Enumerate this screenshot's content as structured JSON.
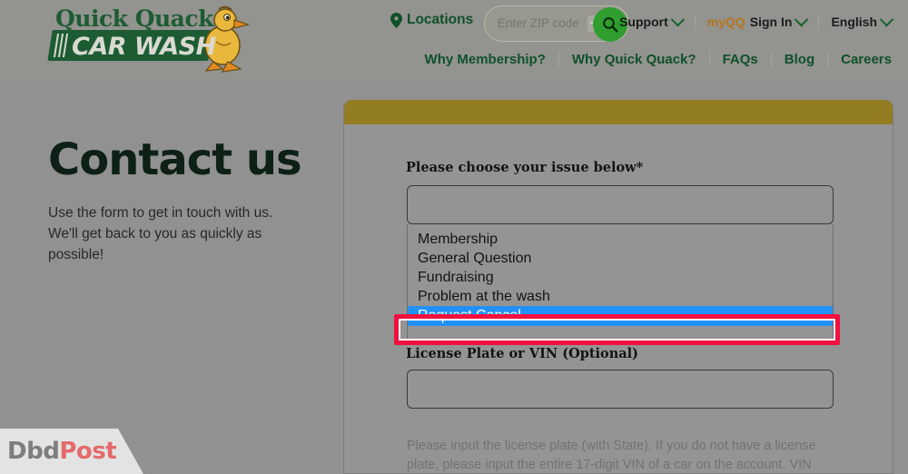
{
  "header": {
    "logo": {
      "line1": "Quick Quack",
      "line2": "CAR WASH",
      "duck_icon": "duck-mascot-icon"
    },
    "locations_label": "Locations",
    "locations_icon": "map-pin-icon",
    "zip": {
      "placeholder": "Enter ZIP code",
      "value": "",
      "search_icon": "search-icon"
    },
    "top_nav": [
      {
        "label": "Support",
        "brand": "",
        "has_chevron": true
      },
      {
        "label": "Sign In",
        "brand": "myQQ",
        "has_chevron": true
      },
      {
        "label": "English",
        "brand": "",
        "has_chevron": true
      }
    ],
    "main_nav": [
      {
        "label": "Why Membership?"
      },
      {
        "label": "Why Quick Quack?"
      },
      {
        "label": "FAQs"
      },
      {
        "label": "Blog"
      },
      {
        "label": "Careers"
      }
    ]
  },
  "left": {
    "title": "Contact us",
    "subtitle": "Use the form to get in touch with us. We'll get back to you as quickly as possible!"
  },
  "form": {
    "issue_label": "Please choose your issue below*",
    "issue_selected_value": "",
    "issue_options": [
      "Membership",
      "General Question",
      "Fundraising",
      "Problem at the wash",
      "Request Cancel"
    ],
    "issue_highlighted": "Request Cancel",
    "plate_label": "License Plate or VIN (Optional)",
    "plate_value": "",
    "plate_placeholder": "",
    "plate_hint": "Please input the license plate (with State). If you do not have a license plate, please input the entire 17-digit VIN of a car on the account. VIN"
  },
  "annotation": {
    "type": "highlight-rectangle",
    "color": "#f2103f",
    "target": "Request Cancel"
  },
  "watermark": {
    "part1": "Dbd",
    "part2": "Post"
  },
  "colors": {
    "page_background": "#919191",
    "header_background": "#93938f",
    "card_topbar_gold": "#937d23",
    "brand_green": "#0f5129",
    "brand_orange": "#b5761f",
    "selection_blue": "#2291f7",
    "annotation_red": "#f2103f"
  }
}
